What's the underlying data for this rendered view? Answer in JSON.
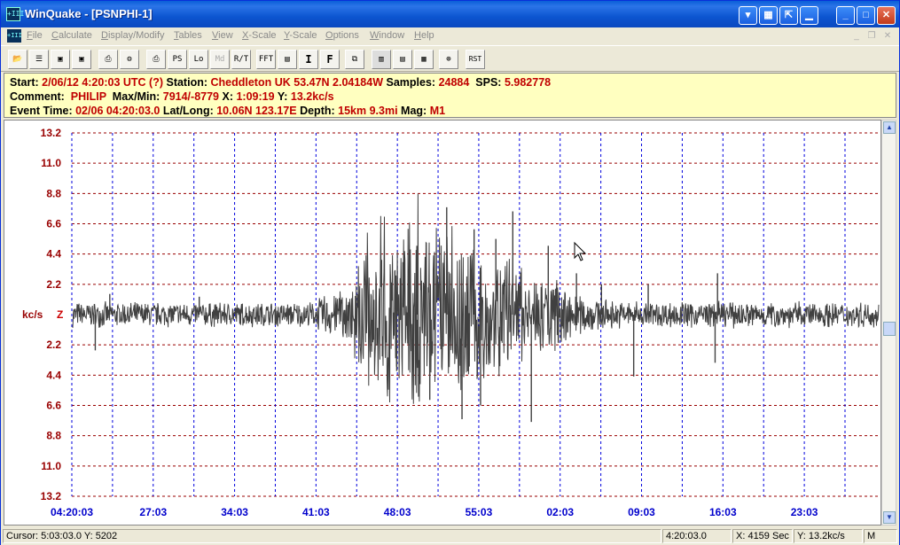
{
  "window": {
    "title": "WinQuake - [PSNPHI-1]",
    "app_icon_label": "+III"
  },
  "menu": {
    "items": [
      {
        "label": "File",
        "u": "F",
        "rest": "ile"
      },
      {
        "label": "Calculate",
        "u": "C",
        "rest": "alculate"
      },
      {
        "label": "Display/Modify",
        "u": "D",
        "rest": "isplay/Modify"
      },
      {
        "label": "Tables",
        "u": "T",
        "rest": "ables"
      },
      {
        "label": "View",
        "u": "V",
        "rest": "iew"
      },
      {
        "label": "X-Scale",
        "u": "X",
        "rest": "-Scale"
      },
      {
        "label": "Y-Scale",
        "u": "Y",
        "rest": "-Scale"
      },
      {
        "label": "Options",
        "u": "O",
        "rest": "ptions"
      },
      {
        "label": "Window",
        "u": "W",
        "rest": "indow"
      },
      {
        "label": "Help",
        "u": "H",
        "rest": "elp"
      }
    ]
  },
  "toolbar": {
    "buttons": [
      "PS",
      "Lo",
      "Md",
      "R/T",
      "FFT",
      "I",
      "F",
      "RST"
    ]
  },
  "info": {
    "start_label": "Start:",
    "start_value": "2/06/12  4:20:03 UTC (?)",
    "station_label": "Station:",
    "station_value": "Cheddleton UK 53.47N 2.04184W",
    "samples_label": "Samples:",
    "samples_value": "24884",
    "sps_label": "SPS:",
    "sps_value": "5.982778",
    "comment_label": "Comment:",
    "comment_value": "PHILIP",
    "maxmin_label": "Max/Min:",
    "maxmin_value": "7914/-8779",
    "x_label": "X:",
    "x_value": "1:09:19",
    "y_label": "Y:",
    "y_value": "13.2kc/s",
    "event_label": "Event Time:",
    "event_value": "02/06 04:20:03.0",
    "latlong_label": "Lat/Long:",
    "latlong_value": "10.06N 123.17E",
    "depth_label": "Depth:",
    "depth_value": "15km 9.3mi",
    "mag_label": "Mag:",
    "mag_value": "M1"
  },
  "chart_data": {
    "type": "line",
    "ylabel": "kc/s",
    "channel": "Z",
    "y_tick_labels": [
      "13.2",
      "11.0",
      "8.8",
      "6.6",
      "4.4",
      "2.2",
      "2.2",
      "4.4",
      "6.6",
      "8.8",
      "11.0",
      "13.2"
    ],
    "ylim": [
      -13.2,
      13.2
    ],
    "x_tick_labels": [
      "04:20:03",
      "27:03",
      "34:03",
      "41:03",
      "48:03",
      "55:03",
      "02:03",
      "09:03",
      "16:03",
      "23:03"
    ],
    "grid": true,
    "colors": {
      "trace": "#404040",
      "hgrid": "#990000",
      "vgrid": "#0000dd",
      "xticks": "#0000cc",
      "yticks": "#990000"
    },
    "envelope": [
      [
        0,
        1.0
      ],
      [
        0.3,
        1.0
      ],
      [
        0.31,
        1.6
      ],
      [
        0.345,
        2.4
      ],
      [
        0.36,
        5.0
      ],
      [
        0.385,
        6.5
      ],
      [
        0.42,
        7.5
      ],
      [
        0.45,
        7.0
      ],
      [
        0.475,
        6.5
      ],
      [
        0.52,
        5.5
      ],
      [
        0.55,
        4.0
      ],
      [
        0.595,
        3.0
      ],
      [
        0.63,
        1.6
      ],
      [
        0.67,
        1.1
      ],
      [
        1.0,
        1.0
      ]
    ],
    "spikes": [
      [
        0.028,
        -2.6
      ],
      [
        0.046,
        1.5
      ],
      [
        0.157,
        1.3
      ],
      [
        0.402,
        -4.1
      ],
      [
        0.427,
        5.0
      ],
      [
        0.443,
        -6.2
      ],
      [
        0.464,
        7.8
      ],
      [
        0.483,
        -7.6
      ],
      [
        0.498,
        6.2
      ],
      [
        0.506,
        -6.6
      ],
      [
        0.525,
        5.5
      ],
      [
        0.546,
        7.5
      ],
      [
        0.569,
        -7.8
      ],
      [
        0.59,
        5.0
      ],
      [
        0.625,
        3.0
      ],
      [
        0.656,
        2.2
      ],
      [
        0.696,
        -4.5
      ],
      [
        0.714,
        2.2
      ],
      [
        0.8,
        3.0
      ],
      [
        0.797,
        -3.5
      ]
    ]
  },
  "status": {
    "cursor": "Cursor: 5:03:03.0  Y: 5202",
    "time": "4:20:03.0",
    "xsec": "X: 4159 Sec",
    "ykcs": "Y: 13.2kc/s",
    "mode": "M"
  }
}
